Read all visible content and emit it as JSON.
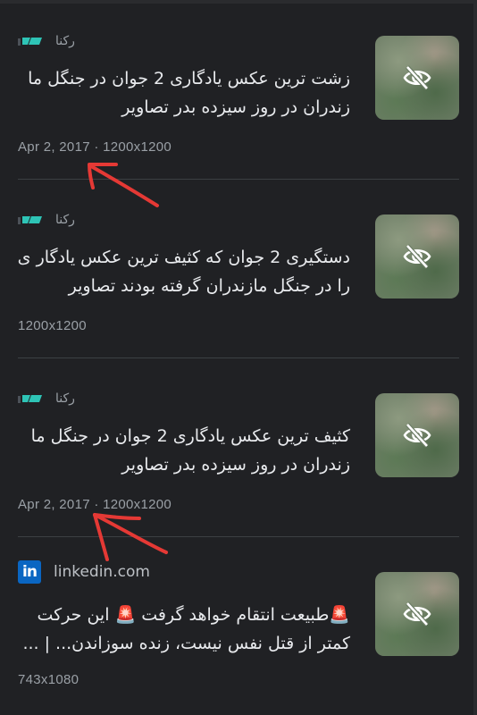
{
  "results": [
    {
      "source": "رکنا",
      "title": "زشت ترین عکس یادگاری 2 جوان در جنگل ما زندران در روز سیزده بدر تصاویر",
      "meta": "Apr 2, 2017 · 1200x1200",
      "source_icon": "rokna-logo",
      "thumb_icon": "eye-off-icon"
    },
    {
      "source": "رکنا",
      "title": "دستگیری 2 جوان که کثیف ترین عکس یادگار ی را در جنگل مازندران گرفته بودند تصاویر",
      "meta": "1200x1200",
      "source_icon": "rokna-logo",
      "thumb_icon": "eye-off-icon"
    },
    {
      "source": "رکنا",
      "title": "کثیف ترین عکس یادگاری 2 جوان در جنگل ما زندران در روز سیزده بدر تصاویر",
      "meta": "Apr 2, 2017 · 1200x1200",
      "source_icon": "rokna-logo",
      "thumb_icon": "eye-off-icon"
    },
    {
      "source": "linkedin.com",
      "title": "🚨طبیعت انتقام خواهد گرفت 🚨 این حرکت کمتر از قتل نفس نیست، زنده سوزاندن... | ...",
      "meta": "743x1080",
      "source_icon": "linkedin-logo",
      "thumb_icon": "eye-off-icon"
    }
  ],
  "colors": {
    "background": "#202124",
    "title_text": "#e8eaed",
    "meta_text": "#9aa0a6",
    "annotation_arrow": "#e53935",
    "rokna_logo": "#2ec4b6",
    "linkedin_logo": "#0a66c2"
  }
}
